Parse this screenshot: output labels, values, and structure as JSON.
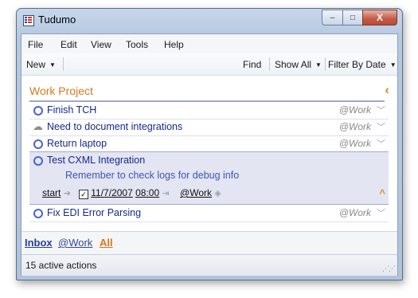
{
  "window": {
    "title": "Tudumo",
    "min_glyph": "–",
    "max_glyph": "□",
    "close_glyph": "X"
  },
  "menu": {
    "items": [
      "File",
      "Edit",
      "View",
      "Tools",
      "Help"
    ]
  },
  "toolbar": {
    "new_label": "New",
    "find_label": "Find",
    "show_all_label": "Show All",
    "filter_label": "Filter By Date"
  },
  "project": {
    "title": "Work Project"
  },
  "tasks": [
    {
      "text": "Finish TCH",
      "context": "@Work",
      "status_icon": "circle-icon"
    },
    {
      "text": "Need to document integrations",
      "context": "@Work",
      "status_icon": "cloud-icon"
    },
    {
      "text": "Return laptop",
      "context": "@Work",
      "status_icon": "circle-icon"
    },
    {
      "text": "Test CXML Integration",
      "status_icon": "circle-icon",
      "selected": true
    },
    {
      "text": "Fix EDI Error Parsing",
      "context": "@Work",
      "status_icon": "circle-icon"
    }
  ],
  "selected_task": {
    "note": "Remember to check logs for debug info",
    "start_label": "start",
    "date_checked": true,
    "date": "11/7/2007",
    "time": "08:00",
    "context": "@Work"
  },
  "views": {
    "inbox": "Inbox",
    "work": "@Work",
    "all": "All"
  },
  "status": {
    "text": "15 active actions"
  },
  "colors": {
    "accent_orange": "#d9771d",
    "task_blue": "#152a8a",
    "selection_bg": "#e3e5f3"
  }
}
